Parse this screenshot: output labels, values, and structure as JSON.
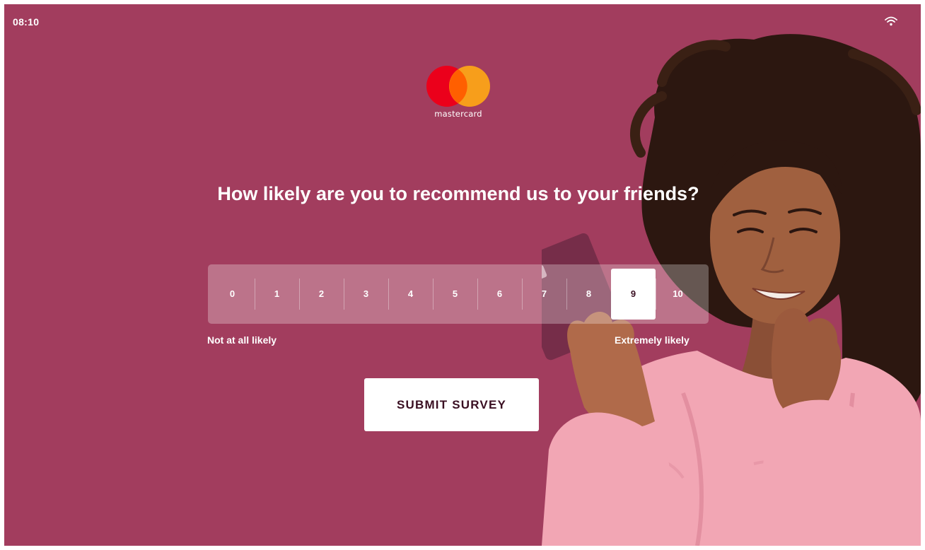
{
  "status_bar": {
    "time": "08:10",
    "icons": [
      "wifi-icon"
    ]
  },
  "brand": {
    "logo_text": "mastercard",
    "colors": {
      "red": "#eb001b",
      "orange": "#f79e1b",
      "overlap": "#ff5f00"
    }
  },
  "survey": {
    "question": "How likely are you to recommend us to your friends?",
    "scale": [
      "0",
      "1",
      "2",
      "3",
      "4",
      "5",
      "6",
      "7",
      "8",
      "9",
      "10"
    ],
    "selected": "9",
    "low_label": "Not at all likely",
    "high_label": "Extremely likely",
    "submit_label": "SUBMIT SURVEY"
  },
  "theme": {
    "background": "#a23d5e",
    "button_text": "#3a0f22"
  }
}
